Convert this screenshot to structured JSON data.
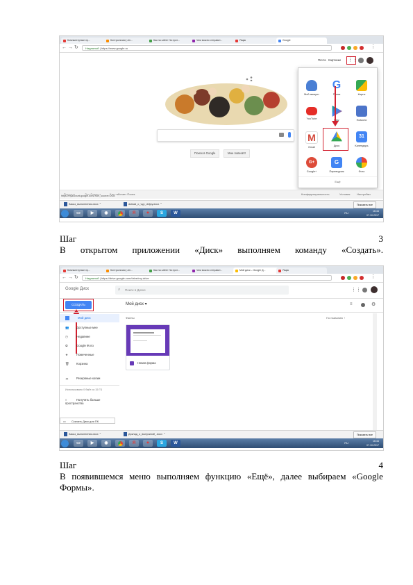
{
  "screenshot1": {
    "tabs": [
      "Компьютерные пр...",
      "Контрольная | Ан...",
      "Как на сайте На прот...",
      "Чем можно отправит...",
      "Ящик",
      "Google"
    ],
    "url_secure": "Надежный",
    "url": "https://www.google.ru",
    "top_links": [
      "Почта",
      "Картинки"
    ],
    "search_buttons": [
      "Поиск в Google",
      "Мне повезёт!"
    ],
    "apps": [
      {
        "label": "Мой аккаунт",
        "color": "#4a7fd4"
      },
      {
        "label": "Поиск",
        "color": "#ffffff"
      },
      {
        "label": "Карты",
        "color": "#34a853"
      },
      {
        "label": "YouTube",
        "color": "#e52d27"
      },
      {
        "label": "Play",
        "color": "#00a173"
      },
      {
        "label": "Новости",
        "color": "#4c74c9"
      },
      {
        "label": "Gmail",
        "color": "#d44638"
      },
      {
        "label": "Диск",
        "color": "#fbbc05"
      },
      {
        "label": "Календарь",
        "color": "#4285f4"
      },
      {
        "label": "Google+",
        "color": "#dd4b39"
      },
      {
        "label": "Переводчик",
        "color": "#4285f4"
      },
      {
        "label": "Фото",
        "color": "#f4b400"
      }
    ],
    "apps_more": "Ещё",
    "footer_left": [
      "Реклама",
      "Для бизнеса",
      "Как работает Поиск"
    ],
    "footer_right": [
      "Конфиденциальность",
      "Условия",
      "Настройки"
    ],
    "status_url": "https://myaccount.google.com/?utm_source=OGB",
    "downloads": [
      "Заказ_выполнения.docx",
      "doklad_o_vyp_deljoy.docx"
    ],
    "show_all": "Показать все",
    "tray_lang": "RU",
    "clock_time": "16:44",
    "clock_date": "07.10.2017"
  },
  "step3": {
    "label": "Шаг",
    "number": "3",
    "text": [
      "В",
      "открытом",
      "приложении",
      "«Диск»",
      "выполняем",
      "команду",
      "«Создать»."
    ]
  },
  "screenshot2": {
    "tabs": [
      "Компьютерные пр...",
      "Контрольная | Ан...",
      "Как на сайте На прот...",
      "Чем можно отправит...",
      "Мой диск – Google Д...",
      "Ящик"
    ],
    "url_secure": "Надежный",
    "url": "https://drive.google.com/drive/my-drive",
    "logo": "Google Диск",
    "search_placeholder": "Поиск в Диске",
    "create_button": "СОЗДАТЬ",
    "my_drive_title": "Мой диск",
    "nav": [
      "Мой диск",
      "Доступные мне",
      "Недавние",
      "Google Фото",
      "Помеченные",
      "Корзина"
    ],
    "backup": "Резервные копии",
    "storage_text": "Использовано 0 байт из 15 ГБ",
    "more_space": "Получить больше пространства",
    "files_label": "Файлы",
    "sort_label": "По названию",
    "file_name": "Новая форма",
    "download_pc": "Скачать Диск для ПК",
    "downloads": [
      "Заказ_выполнения.docx",
      "Доклад_о_выпускной_.docx"
    ],
    "show_all": "Показать все",
    "tray_lang": "RU",
    "clock_time": "16:44",
    "clock_date": "07.10.2017"
  },
  "step4": {
    "label": "Шаг",
    "number": "4",
    "line1": [
      "В",
      "появившемся",
      "меню",
      "выполняем",
      "функцию",
      "«Ещё»,",
      "далее",
      "выбираем",
      "«Google"
    ],
    "line2": "Формы»."
  }
}
